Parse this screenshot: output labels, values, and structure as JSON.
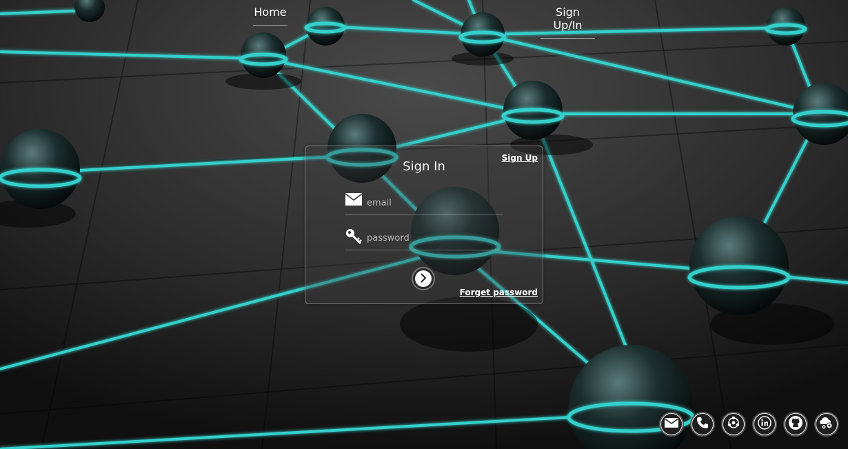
{
  "nav": {
    "home_label": "Home",
    "signup_label": "Sign Up/In"
  },
  "signin": {
    "title": "Sign In",
    "signup_link": "Sign Up",
    "email_placeholder": "email",
    "password_placeholder": "password",
    "forgot_link": "Forget password"
  },
  "social": [
    {
      "icon": "email-icon"
    },
    {
      "icon": "phone-icon"
    },
    {
      "icon": "network-icon"
    },
    {
      "icon": "linkedin-icon"
    },
    {
      "icon": "github-icon"
    },
    {
      "icon": "cloud-settings-icon"
    }
  ],
  "colors": {
    "accent": "#35d0cc",
    "background": "#1a1a1a"
  }
}
